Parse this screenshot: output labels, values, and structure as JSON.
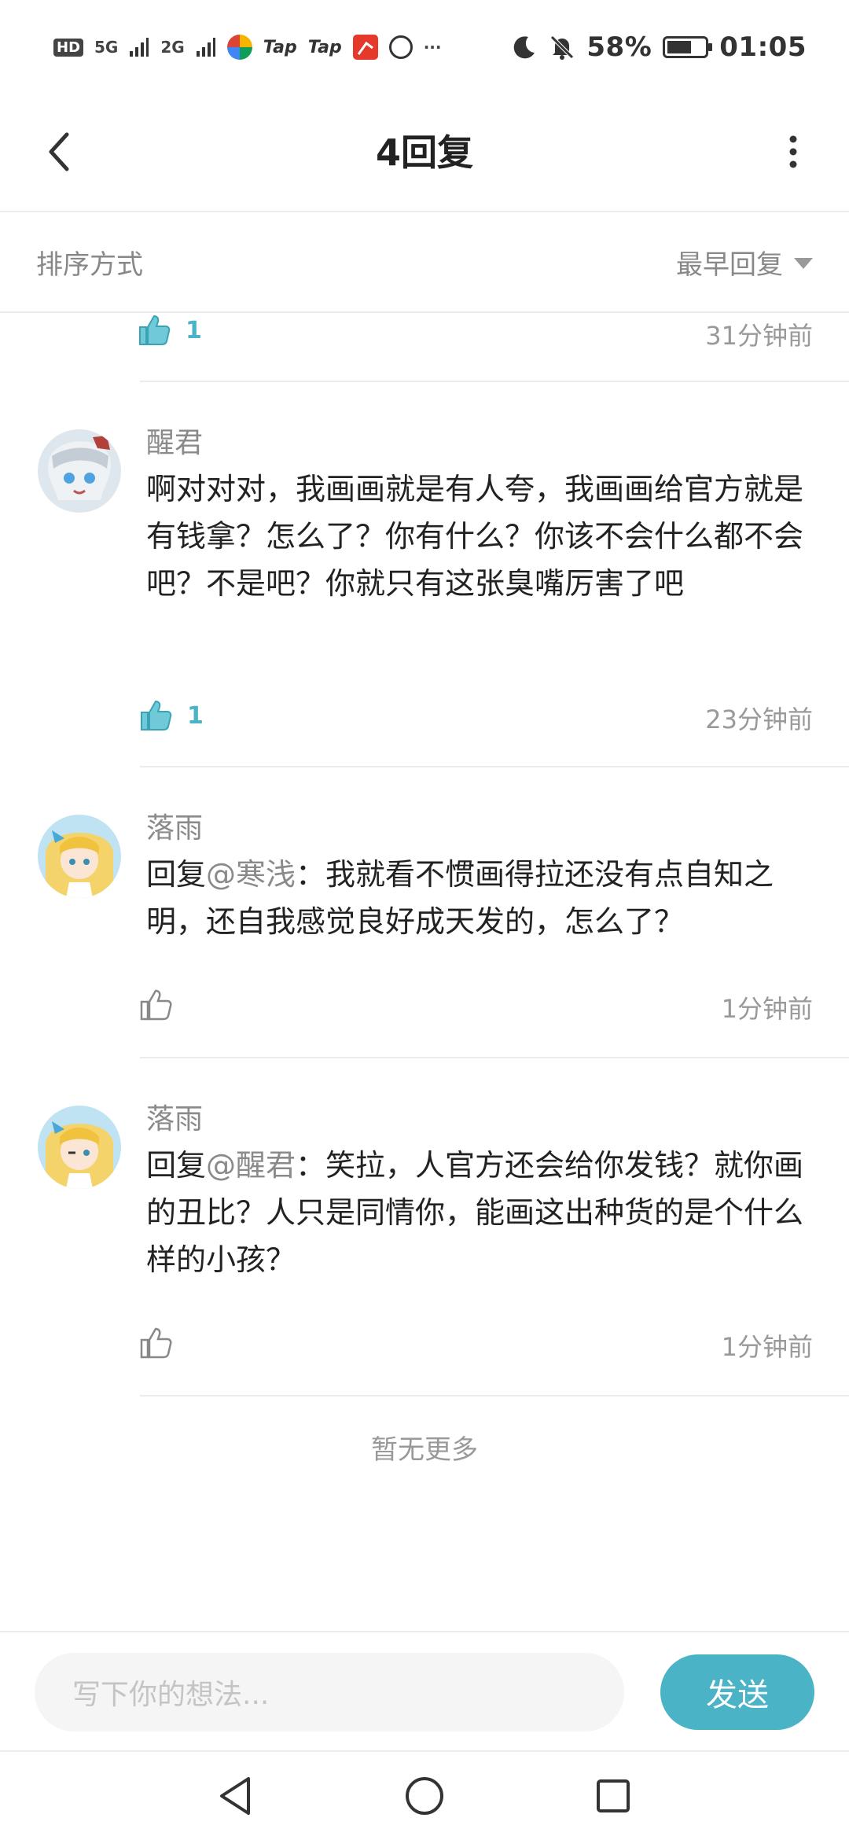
{
  "status_bar": {
    "hd": "HD",
    "net1": "5G",
    "net2": "2G",
    "tap1": "Tap",
    "tap2": "Tap",
    "more": "···",
    "battery": "58%",
    "time": "01:05"
  },
  "header": {
    "title": "4回复"
  },
  "sort": {
    "label": "排序方式",
    "selected": "最早回复"
  },
  "first_row": {
    "likes": "1",
    "time": "31分钟前"
  },
  "replies": [
    {
      "user": "醒君",
      "prefix": "",
      "mention": "",
      "text": "啊对对对，我画画就是有人夸，我画画给官方就是有钱拿？怎么了？你有什么？你该不会什么都不会吧？不是吧？你就只有这张臭嘴厉害了吧",
      "likes": "1",
      "liked": true,
      "time": "23分钟前"
    },
    {
      "user": "落雨",
      "prefix": "回复",
      "mention": "@寒浅",
      "text": "：我就看不惯画得拉还没有点自知之明，还自我感觉良好成天发的，怎么了？",
      "likes": "",
      "liked": false,
      "time": "1分钟前"
    },
    {
      "user": "落雨",
      "prefix": "回复",
      "mention": "@醒君",
      "text": "：笑拉，人官方还会给你发钱？就你画的丑比？人只是同情你，能画这出种货的是个什么样的小孩？",
      "likes": "",
      "liked": false,
      "time": "1分钟前"
    }
  ],
  "footer": {
    "no_more": "暂无更多"
  },
  "input": {
    "placeholder": "写下你的想法...",
    "send": "发送"
  },
  "colors": {
    "accent": "#4ab3c5",
    "muted": "#999999",
    "text": "#222222"
  }
}
